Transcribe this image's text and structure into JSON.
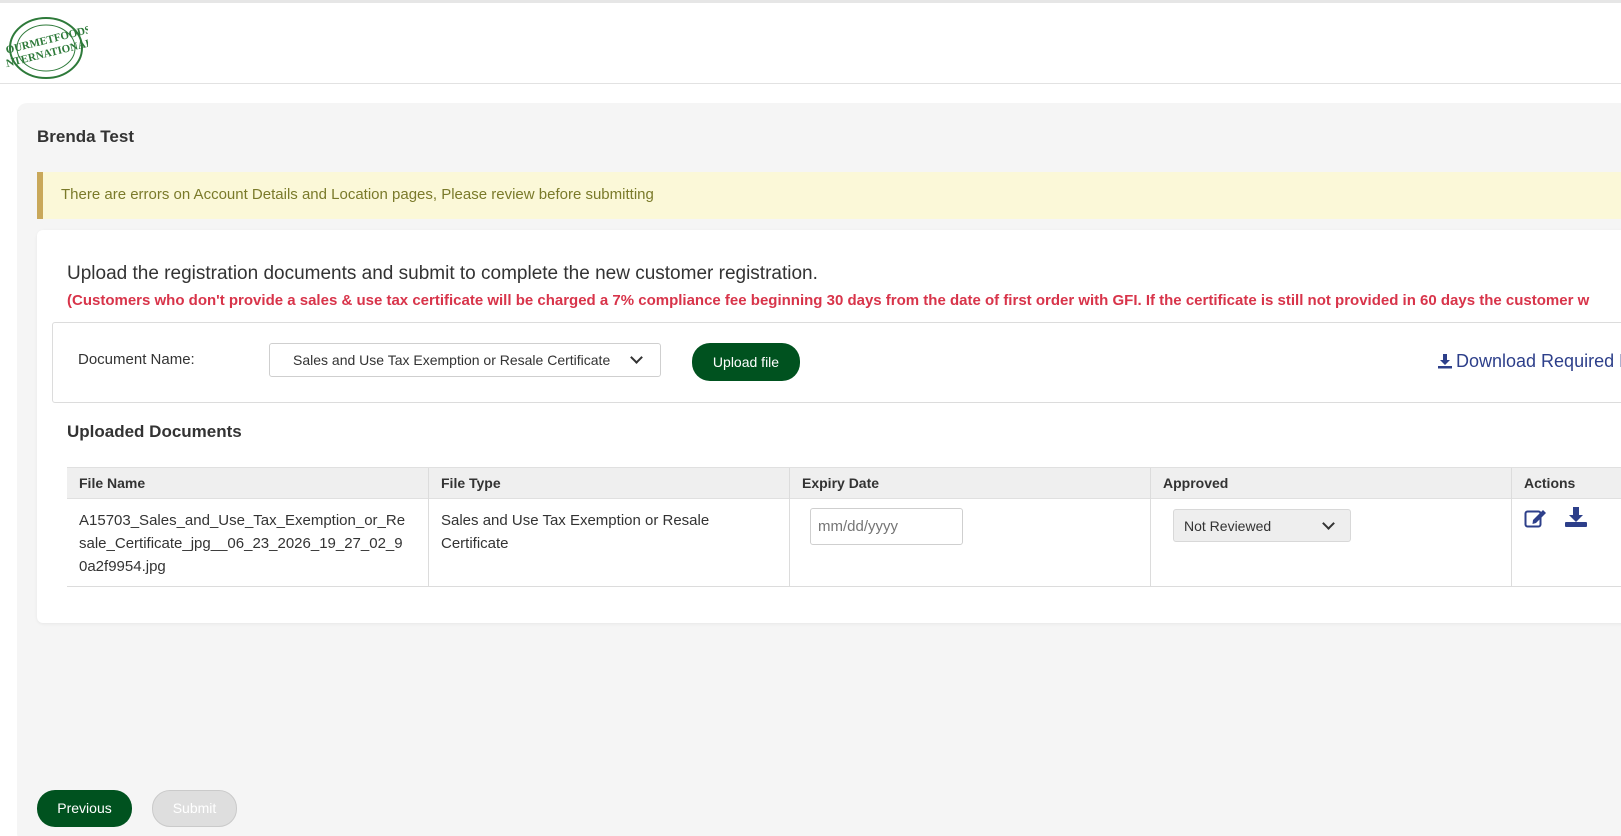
{
  "brand": {
    "logo_text": "GOURMET FOODS INTERNATIONAL",
    "accent_color": "#00521f"
  },
  "customer": {
    "name": "Brenda Test"
  },
  "alert": {
    "message": "There are errors on Account Details and Location pages, Please review before submitting"
  },
  "upload": {
    "intro": "Upload the registration documents and submit to complete the new customer registration.",
    "warning": "(Customers who don't provide a sales & use tax certificate will be charged a 7% compliance fee beginning 30 days from the date of first order with GFI. If the certificate is still not provided in 60 days the customer w",
    "document_label": "Document Name:",
    "document_selected": "Sales and Use Tax Exemption or Resale Certificate",
    "upload_button": "Upload file",
    "download_link": "Download Required F"
  },
  "documents": {
    "title": "Uploaded Documents",
    "columns": [
      "File Name",
      "File Type",
      "Expiry Date",
      "Approved",
      "Actions"
    ],
    "rows": [
      {
        "file_name": "A15703_Sales_and_Use_Tax_Exemption_or_Resale_Certificate_jpg__06_23_2026_19_27_02_90a2f9954.jpg",
        "file_type": "Sales and Use Tax Exemption or Resale Certificate",
        "expiry_placeholder": "mm/dd/yyyy",
        "approved": "Not Reviewed"
      }
    ]
  },
  "footer": {
    "previous_button": "Previous",
    "submit_button": "Submit"
  },
  "colors": {
    "warning_red": "#d8344a",
    "link_blue": "#2d3f8a",
    "alert_bg": "#fbf8d8"
  }
}
